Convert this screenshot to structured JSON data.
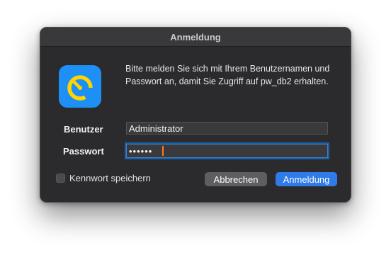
{
  "dialog": {
    "title": "Anmeldung",
    "message": "Bitte melden Sie sich mit Ihrem Benutzernamen und Passwort an, damit Sie Zugriff auf pw_db2 erhalten.",
    "app_icon": "timer-gauge-icon"
  },
  "form": {
    "user_label": "Benutzer",
    "user_value": "Administrator",
    "password_label": "Passwort",
    "password_value": "••••••"
  },
  "options": {
    "remember_label": "Kennwort speichern",
    "remember_checked": false
  },
  "buttons": {
    "cancel_label": "Abbrechen",
    "ok_label": "Anmeldung"
  },
  "colors": {
    "dialog_bg": "#2b2b2d",
    "icon_bg": "#1e8ff5",
    "icon_ring": "#ffd400",
    "primary_button": "#2f7be8",
    "secondary_button": "#5e5e61",
    "focus_ring": "#1c5fa8"
  }
}
